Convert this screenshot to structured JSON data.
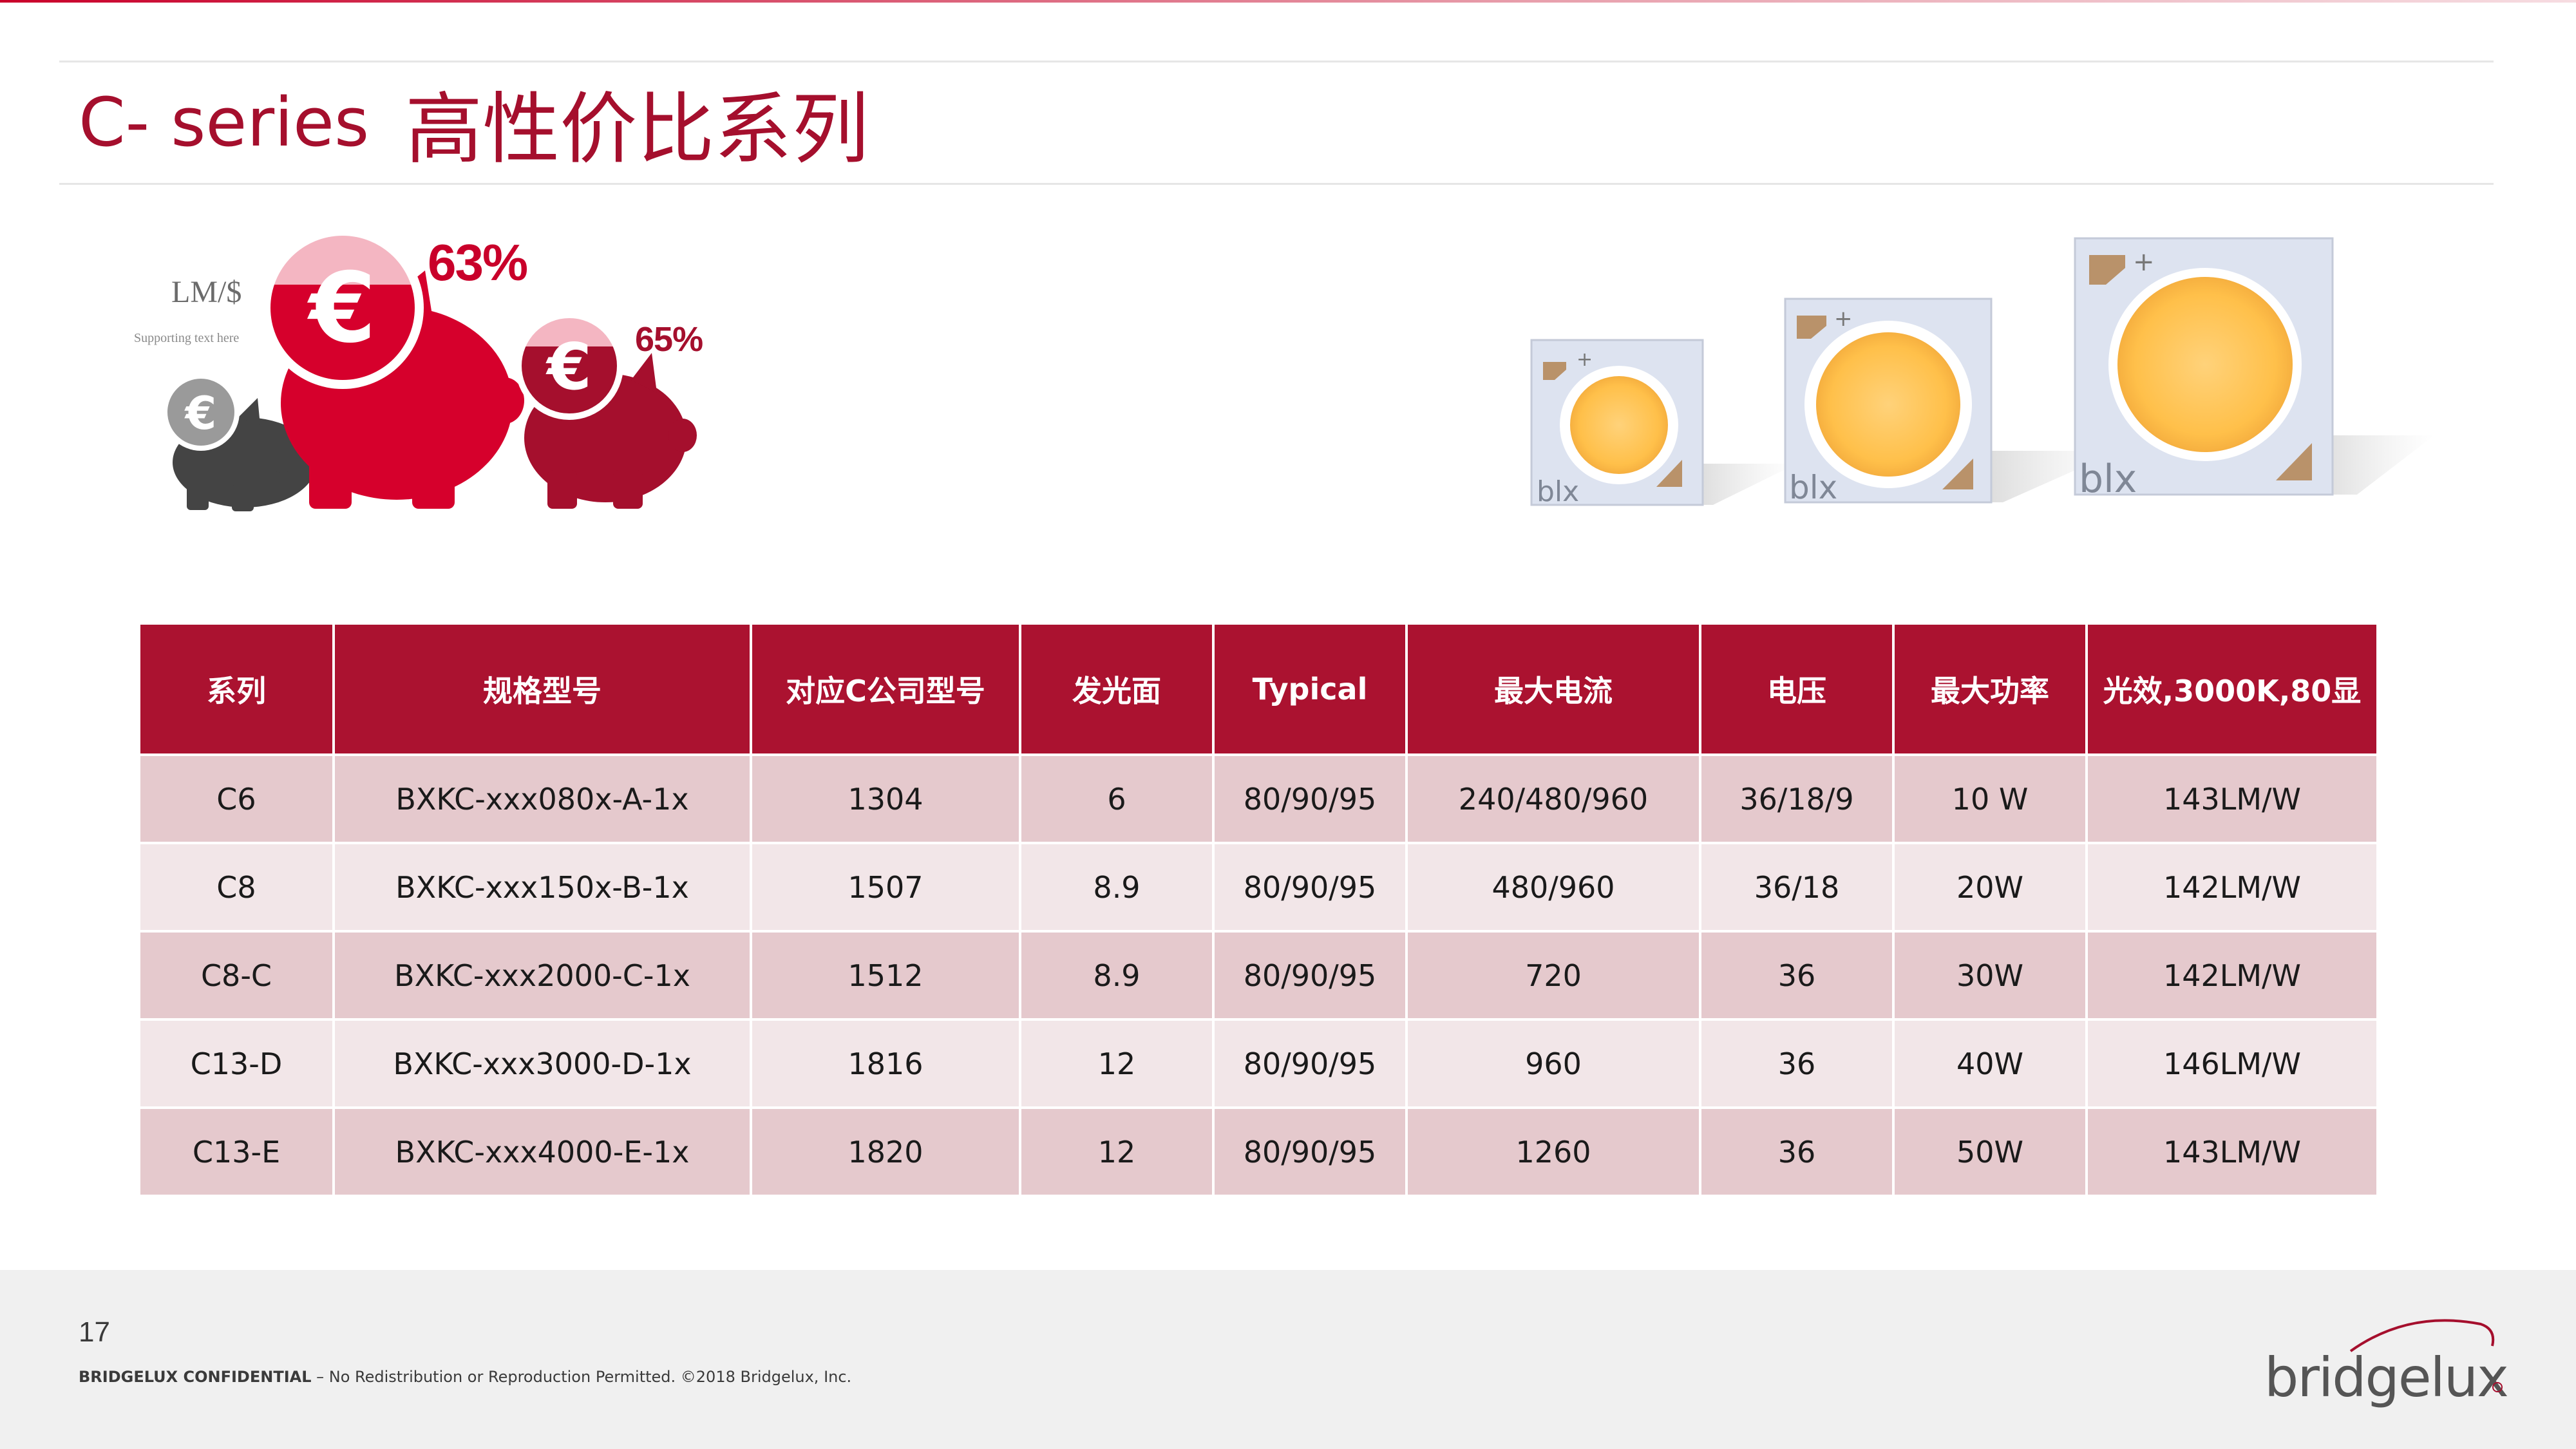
{
  "slide": {
    "title_en": "C- series",
    "title_cn": "高性价比系列",
    "page_number": "17",
    "confidential_bold": "BRIDGELUX CONFIDENTIAL",
    "confidential_rest": " – No Redistribution or Reproduction Permitted. ©2018 Bridgelux, Inc.",
    "logo_text": "bridgelux"
  },
  "graphic": {
    "label": "LM/$",
    "supporting_text": "Supporting text here",
    "pct_large": "63%",
    "pct_small": "65%",
    "currency_symbol": "€",
    "chip_mark": "blx",
    "chip_plus": "+",
    "colors": {
      "red": "#d6002c",
      "dark_red": "#a50f2d",
      "grey": "#444444",
      "accent": "#ab1230"
    }
  },
  "table": {
    "headers": [
      "系列",
      "规格型号",
      "对应C公司型号",
      "发光面",
      "Typical",
      "最大电流",
      "电压",
      "最大功率",
      "光效,3000K,80显"
    ],
    "rows": [
      [
        "C6",
        "BXKC-xxx080x-A-1x",
        "1304",
        "6",
        "80/90/95",
        "240/480/960",
        "36/18/9",
        "10 W",
        "143LM/W"
      ],
      [
        "C8",
        "BXKC-xxx150x-B-1x",
        "1507",
        "8.9",
        "80/90/95",
        "480/960",
        "36/18",
        "20W",
        "142LM/W"
      ],
      [
        "C8-C",
        "BXKC-xxx2000-C-1x",
        "1512",
        "8.9",
        "80/90/95",
        "720",
        "36",
        "30W",
        "142LM/W"
      ],
      [
        "C13-D",
        "BXKC-xxx3000-D-1x",
        "1816",
        "12",
        "80/90/95",
        "960",
        "36",
        "40W",
        "146LM/W"
      ],
      [
        "C13-E",
        "BXKC-xxx4000-E-1x",
        "1820",
        "12",
        "80/90/95",
        "1260",
        "36",
        "50W",
        "143LM/W"
      ]
    ]
  }
}
